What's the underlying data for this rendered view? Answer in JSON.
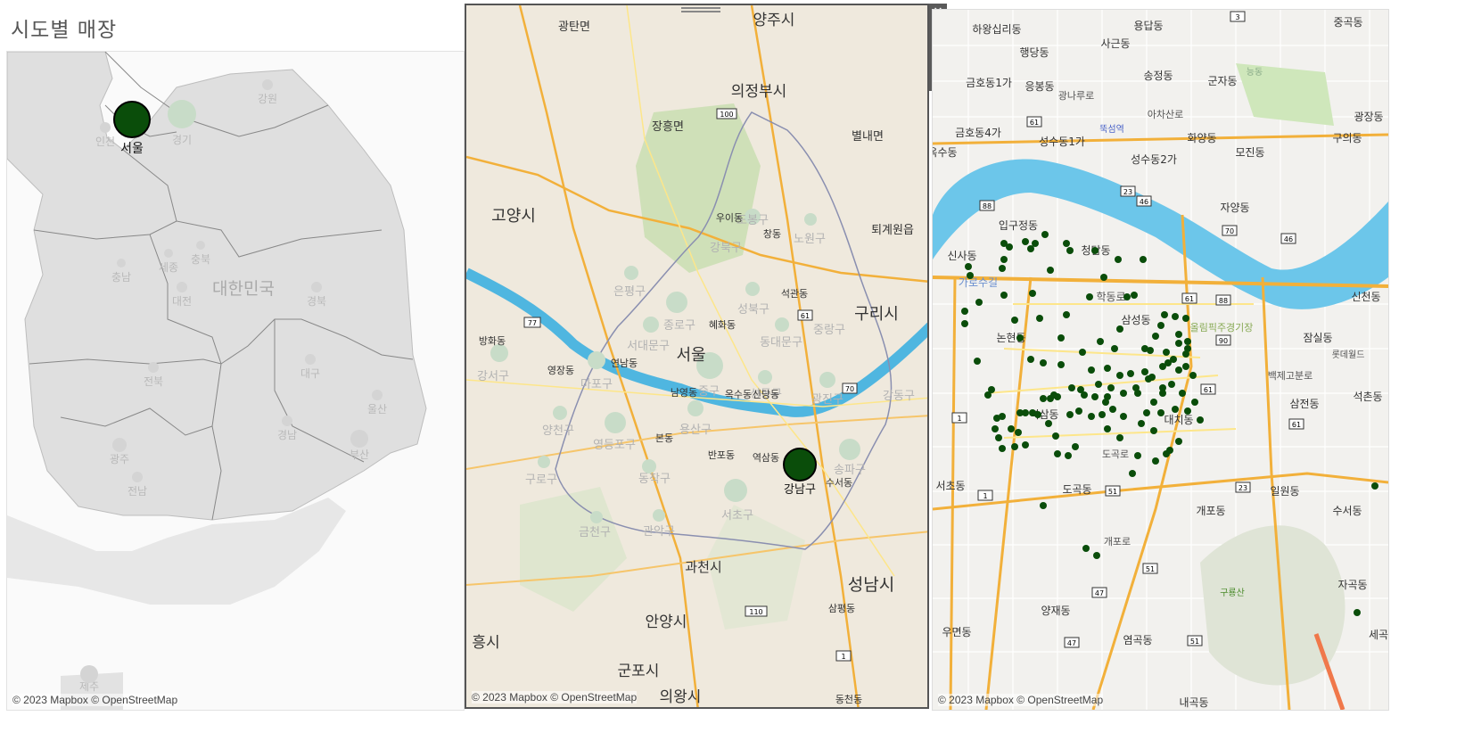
{
  "sheet": {
    "title": "시도별 매장"
  },
  "attribution": "© 2023 Mapbox © OpenStreetMap",
  "colors": {
    "marker": "#0a4d0a",
    "marker_faded": "#c8dcc8",
    "water": "#6cc6ea",
    "river_seoul": "#4fb6e0",
    "road_major": "#f2b03a",
    "road_minor": "#fde68a"
  },
  "map1": {
    "country_label": "대한민국",
    "selected": {
      "label": "서울"
    },
    "regions": [
      "인천",
      "경기",
      "강원",
      "충남",
      "세종",
      "충북",
      "대전",
      "경북",
      "전북",
      "대구",
      "울산",
      "경남",
      "부산",
      "광주",
      "전남",
      "제주"
    ]
  },
  "map2": {
    "selected": {
      "label": "강남구"
    },
    "cities": [
      "양주시",
      "광탄면",
      "의정부시",
      "장흥면",
      "별내면",
      "고양시",
      "퇴계원읍",
      "구리시",
      "서울",
      "과천시",
      "성남시",
      "안양시",
      "흥시",
      "군포시",
      "의왕시",
      "동천동",
      "삼평동"
    ],
    "districts": [
      "은평구",
      "도봉구",
      "노원구",
      "강북구",
      "성북구",
      "종로구",
      "서대문구",
      "동대문구",
      "중랑구",
      "마포구",
      "중구",
      "성동구",
      "광진구",
      "강동구",
      "강서구",
      "양천구",
      "영등포구",
      "용산구",
      "송파구",
      "구로구",
      "동작구",
      "서초구",
      "금천구",
      "관악구",
      "강서구"
    ],
    "neighborhoods": [
      "우이동",
      "창동",
      "석관동",
      "혜화동",
      "연남동",
      "영장동",
      "방화동",
      "남영동",
      "옥수동",
      "신당동",
      "본동",
      "반포동",
      "역삼동",
      "수서동"
    ],
    "road_labels": [
      "100",
      "77",
      "61",
      "70",
      "110",
      "1"
    ]
  },
  "map3": {
    "labels": [
      "하왕십리동",
      "용답동",
      "중곡동",
      "행당동",
      "사근동",
      "금호동1가",
      "응봉동",
      "송정동",
      "군자동",
      "광장동",
      "금호동4가",
      "성수동1가",
      "화양동",
      "구의동",
      "옥수동",
      "성수동2가",
      "모진동",
      "자양동",
      "입구정동",
      "신사동",
      "청담동",
      "가로수길",
      "학동로",
      "삼성동",
      "논현동",
      "올림픽주경기장",
      "잠실동",
      "신천동",
      "대치동",
      "역삼동",
      "도곡로",
      "백제고분로",
      "삼전동",
      "석촌동",
      "서초동",
      "도곡동",
      "일원동",
      "수서동",
      "개포동",
      "개포로",
      "구룡산",
      "자곡동",
      "양재동",
      "염곡동",
      "우면동",
      "내곡동",
      "세곡",
      "뚝섬역",
      "아차산로",
      "광나루로",
      "롯데월드",
      "능동"
    ],
    "road_labels": [
      "3",
      "61",
      "23",
      "46",
      "70",
      "88",
      "46",
      "61",
      "88",
      "90",
      "61",
      "1",
      "51",
      "23",
      "1",
      "51",
      "47",
      "47",
      "51",
      "61"
    ],
    "store_count": 131
  },
  "toolbar": {
    "close_label": "✕",
    "popout_label": "⤢",
    "filter_label": "▼",
    "pin_label": "⊞",
    "more_label": "▾"
  }
}
